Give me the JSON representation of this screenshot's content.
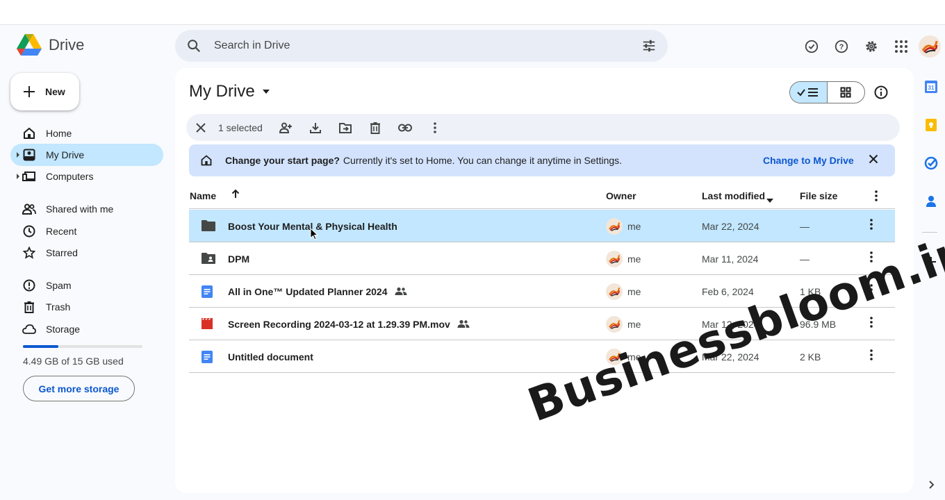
{
  "app": {
    "name": "Drive"
  },
  "search": {
    "placeholder": "Search in Drive"
  },
  "sidebar": {
    "new_label": "New",
    "items": [
      {
        "label": "Home"
      },
      {
        "label": "My Drive"
      },
      {
        "label": "Computers"
      },
      {
        "label": "Shared with me"
      },
      {
        "label": "Recent"
      },
      {
        "label": "Starred"
      },
      {
        "label": "Spam"
      },
      {
        "label": "Trash"
      },
      {
        "label": "Storage"
      }
    ],
    "storage_used_fraction": 0.299,
    "storage_text": "4.49 GB of 15 GB used",
    "get_storage_label": "Get more storage"
  },
  "main": {
    "title": "My Drive",
    "selection": {
      "count_label": "1 selected"
    },
    "banner": {
      "bold": "Change your start page?",
      "text": "Currently it's set to Home. You can change it anytime in Settings.",
      "link": "Change to My Drive"
    },
    "columns": {
      "name": "Name",
      "owner": "Owner",
      "modified": "Last modified",
      "size": "File size"
    },
    "files": [
      {
        "name": "Boost Your Mental & Physical Health",
        "owner": "me",
        "modified": "Mar 22, 2024",
        "size": "—",
        "type": "folder",
        "shared": false,
        "selected": true
      },
      {
        "name": "DPM",
        "owner": "me",
        "modified": "Mar 11, 2024",
        "size": "—",
        "type": "shared-folder",
        "shared": false,
        "selected": false
      },
      {
        "name": "All in One™ Updated Planner 2024",
        "owner": "me",
        "modified": "Feb 6, 2024",
        "size": "1 KB",
        "type": "doc",
        "shared": true,
        "selected": false
      },
      {
        "name": "Screen Recording 2024-03-12 at 1.29.39 PM.mov",
        "owner": "me",
        "modified": "Mar 12, 2024",
        "size": "96.9 MB",
        "type": "video",
        "shared": true,
        "selected": false
      },
      {
        "name": "Untitled document",
        "owner": "me",
        "modified": "Mar 22, 2024",
        "size": "2 KB",
        "type": "doc",
        "shared": false,
        "selected": false
      }
    ]
  },
  "watermark": "Businessbloom.in",
  "colors": {
    "accent": "#0b57d0",
    "selected": "#c2e7ff",
    "banner": "#d3e3fd"
  }
}
